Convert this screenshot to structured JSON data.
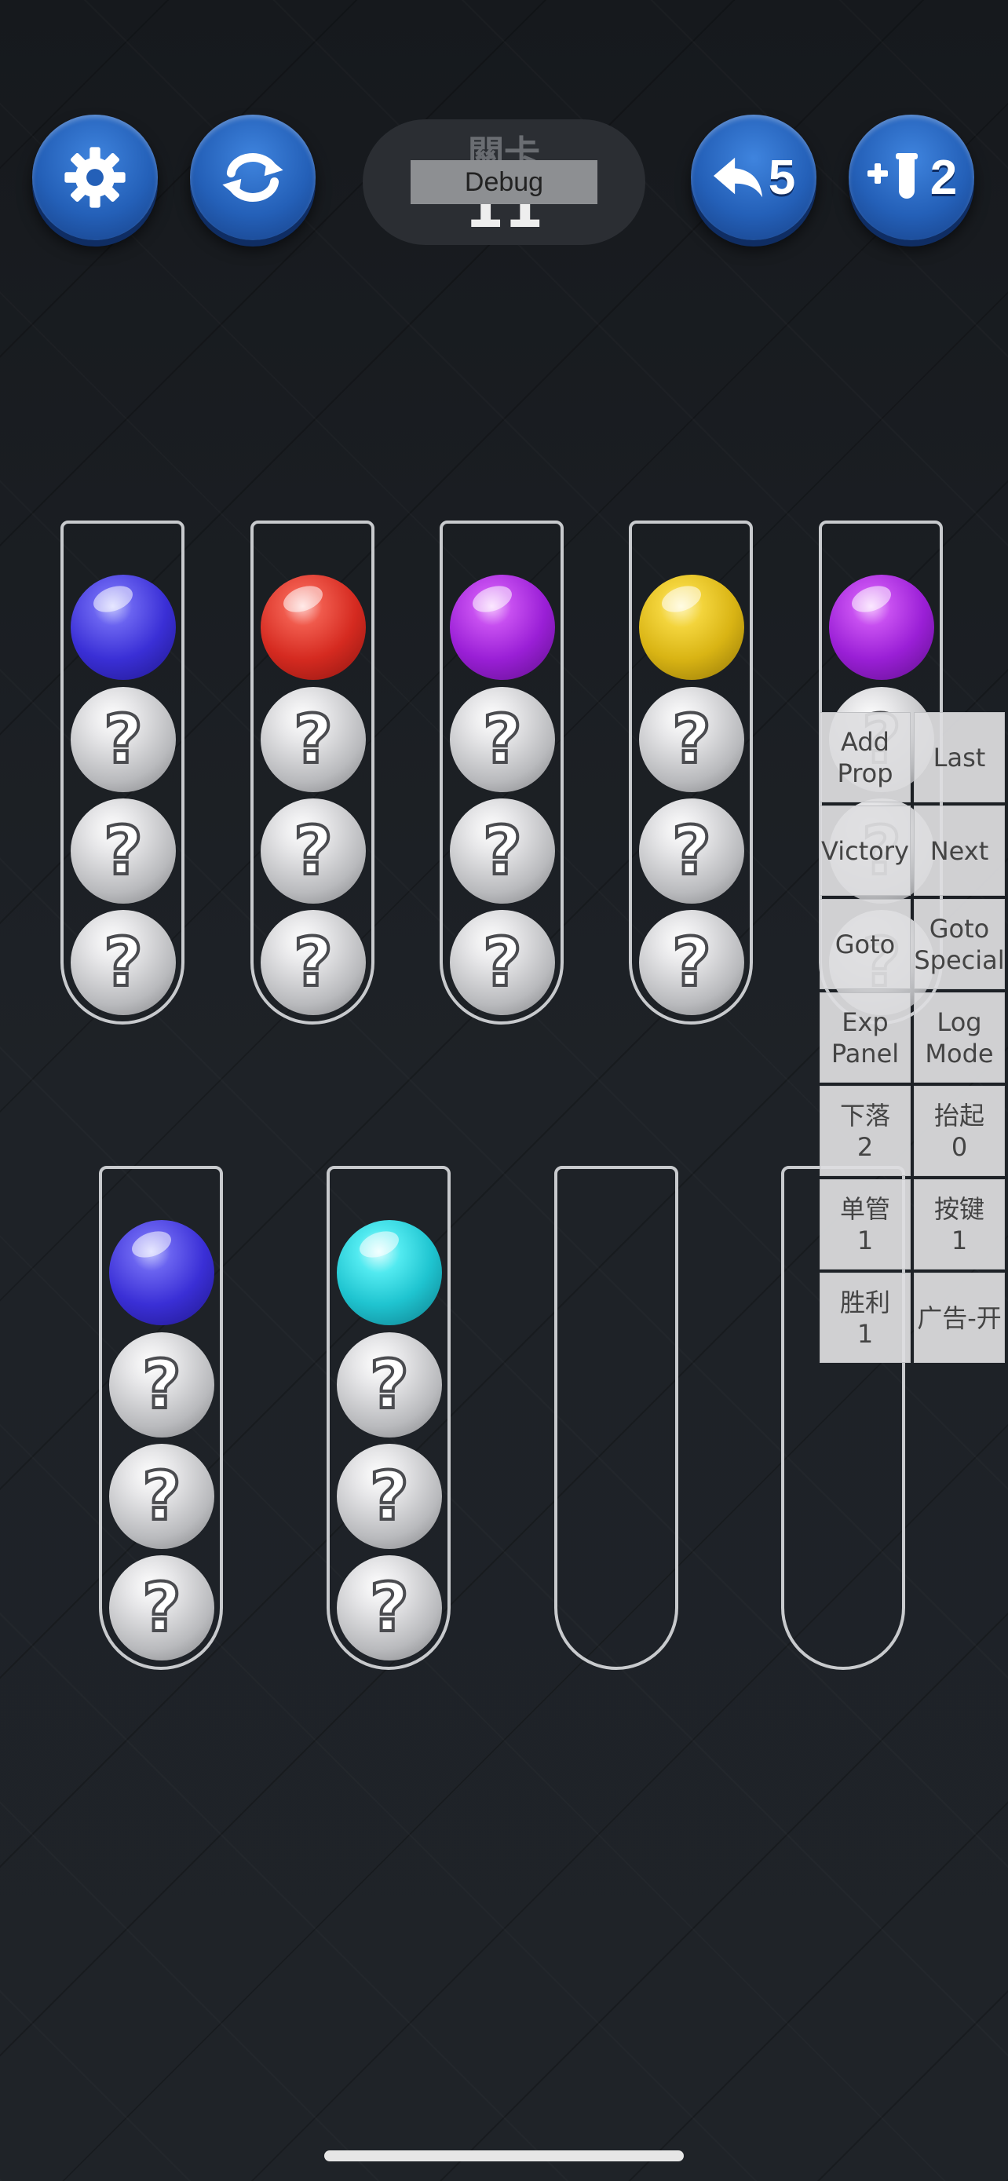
{
  "header": {
    "settings_icon": "gear-icon",
    "restart_icon": "refresh-icon",
    "level_label": "關卡",
    "level_number": "11",
    "debug_label": "Debug",
    "undo_icon": "undo-arrow-icon",
    "undo_count": "5",
    "add_tube_icon": "add-tube-icon",
    "add_tube_count": "2"
  },
  "ball_colors": {
    "blue": "#3a2fd6",
    "red": "#d52a20",
    "purple": "#9a1fd6",
    "yellow": "#d9b414",
    "cyan": "#1fc4d0",
    "unknown": "#b9babd"
  },
  "tubes": [
    {
      "balls": [
        "blue",
        "unknown",
        "unknown",
        "unknown"
      ]
    },
    {
      "balls": [
        "red",
        "unknown",
        "unknown",
        "unknown"
      ]
    },
    {
      "balls": [
        "purple",
        "unknown",
        "unknown",
        "unknown"
      ]
    },
    {
      "balls": [
        "yellow",
        "unknown",
        "unknown",
        "unknown"
      ]
    },
    {
      "balls": [
        "purple",
        "unknown",
        "unknown",
        "unknown"
      ]
    },
    {
      "balls": [
        "blue",
        "unknown",
        "unknown",
        "unknown"
      ]
    },
    {
      "balls": [
        "cyan",
        "unknown",
        "unknown",
        "unknown"
      ]
    },
    {
      "balls": []
    },
    {
      "balls": []
    }
  ],
  "unknown_mark": "?",
  "debug_panel": {
    "buttons": [
      "Add\nProp",
      "Last",
      "Victory",
      "Next",
      "Goto",
      "Goto\nSpecial",
      "Exp\nPanel",
      "Log\nMode",
      "下落\n2",
      "抬起\n0",
      "单管\n1",
      "按键\n1",
      "胜利\n1",
      "广告-开"
    ]
  }
}
